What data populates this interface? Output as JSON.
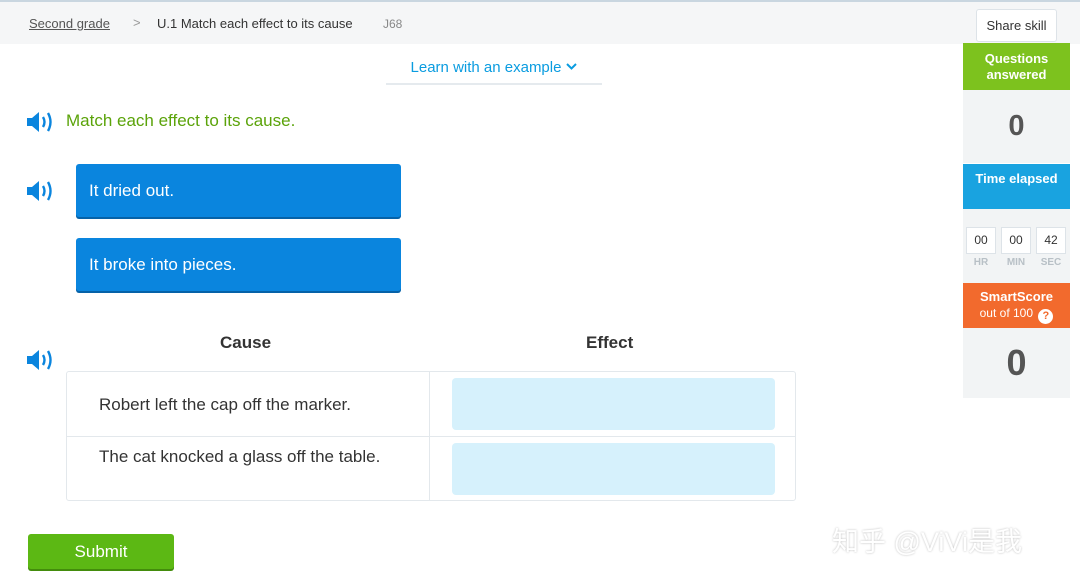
{
  "breadcrumb": {
    "grade": "Second grade",
    "separator": ">",
    "skill_title": "U.1 Match each effect to its cause",
    "skill_code": "J68"
  },
  "header": {
    "share_label": "Share skill"
  },
  "example": {
    "label": "Learn with an example"
  },
  "question": {
    "instruction": "Match each effect to its cause.",
    "tiles": [
      {
        "label": "It dried out."
      },
      {
        "label": "It broke into pieces."
      }
    ],
    "table": {
      "cause_header": "Cause",
      "effect_header": "Effect",
      "rows": [
        {
          "cause": "Robert left the cap off the marker."
        },
        {
          "cause": "The cat knocked a glass off the table."
        }
      ]
    },
    "submit_label": "Submit"
  },
  "sidebar": {
    "questions_answered": {
      "label": "Questions answered",
      "value": "0"
    },
    "time_elapsed": {
      "label": "Time elapsed",
      "hr": "00",
      "min": "00",
      "sec": "42",
      "hr_label": "HR",
      "min_label": "MIN",
      "sec_label": "SEC"
    },
    "smartscore": {
      "label": "SmartScore",
      "sub": "out of 100",
      "help": "?",
      "value": "0"
    }
  },
  "watermark": "知乎 @ViVi是我",
  "colors": {
    "accent_green": "#5cb814",
    "tile_blue": "#0a85de",
    "drop_zone": "#d6f1fc",
    "time_blue": "#19a3e0",
    "smartscore_orange": "#f26a2d"
  }
}
